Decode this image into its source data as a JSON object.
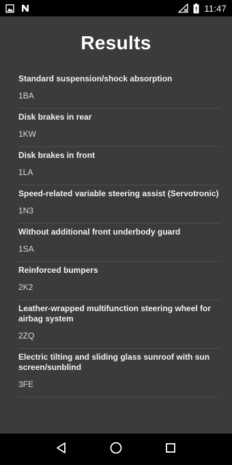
{
  "status_bar": {
    "time": "11:47",
    "icons": [
      "image-icon",
      "n-notification-icon",
      "no-signal-icon",
      "battery-icon"
    ]
  },
  "page": {
    "title": "Results"
  },
  "results": [
    {
      "name": "Standard suspension/shock absorption",
      "code": "1BA"
    },
    {
      "name": "Disk brakes in rear",
      "code": "1KW"
    },
    {
      "name": "Disk brakes in front",
      "code": "1LA"
    },
    {
      "name": "Speed-related variable steering assist (Servotronic)",
      "code": "1N3"
    },
    {
      "name": "Without additional front underbody guard",
      "code": "1SA"
    },
    {
      "name": "Reinforced bumpers",
      "code": "2K2"
    },
    {
      "name": "Leather-wrapped multifunction steering wheel for airbag system",
      "code": "2ZQ"
    },
    {
      "name": "Electric tilting and sliding glass sunroof with sun screen/sunblind",
      "code": "3FE"
    }
  ],
  "nav_bar": {
    "icons": [
      "back-icon",
      "home-icon",
      "recents-icon"
    ]
  }
}
